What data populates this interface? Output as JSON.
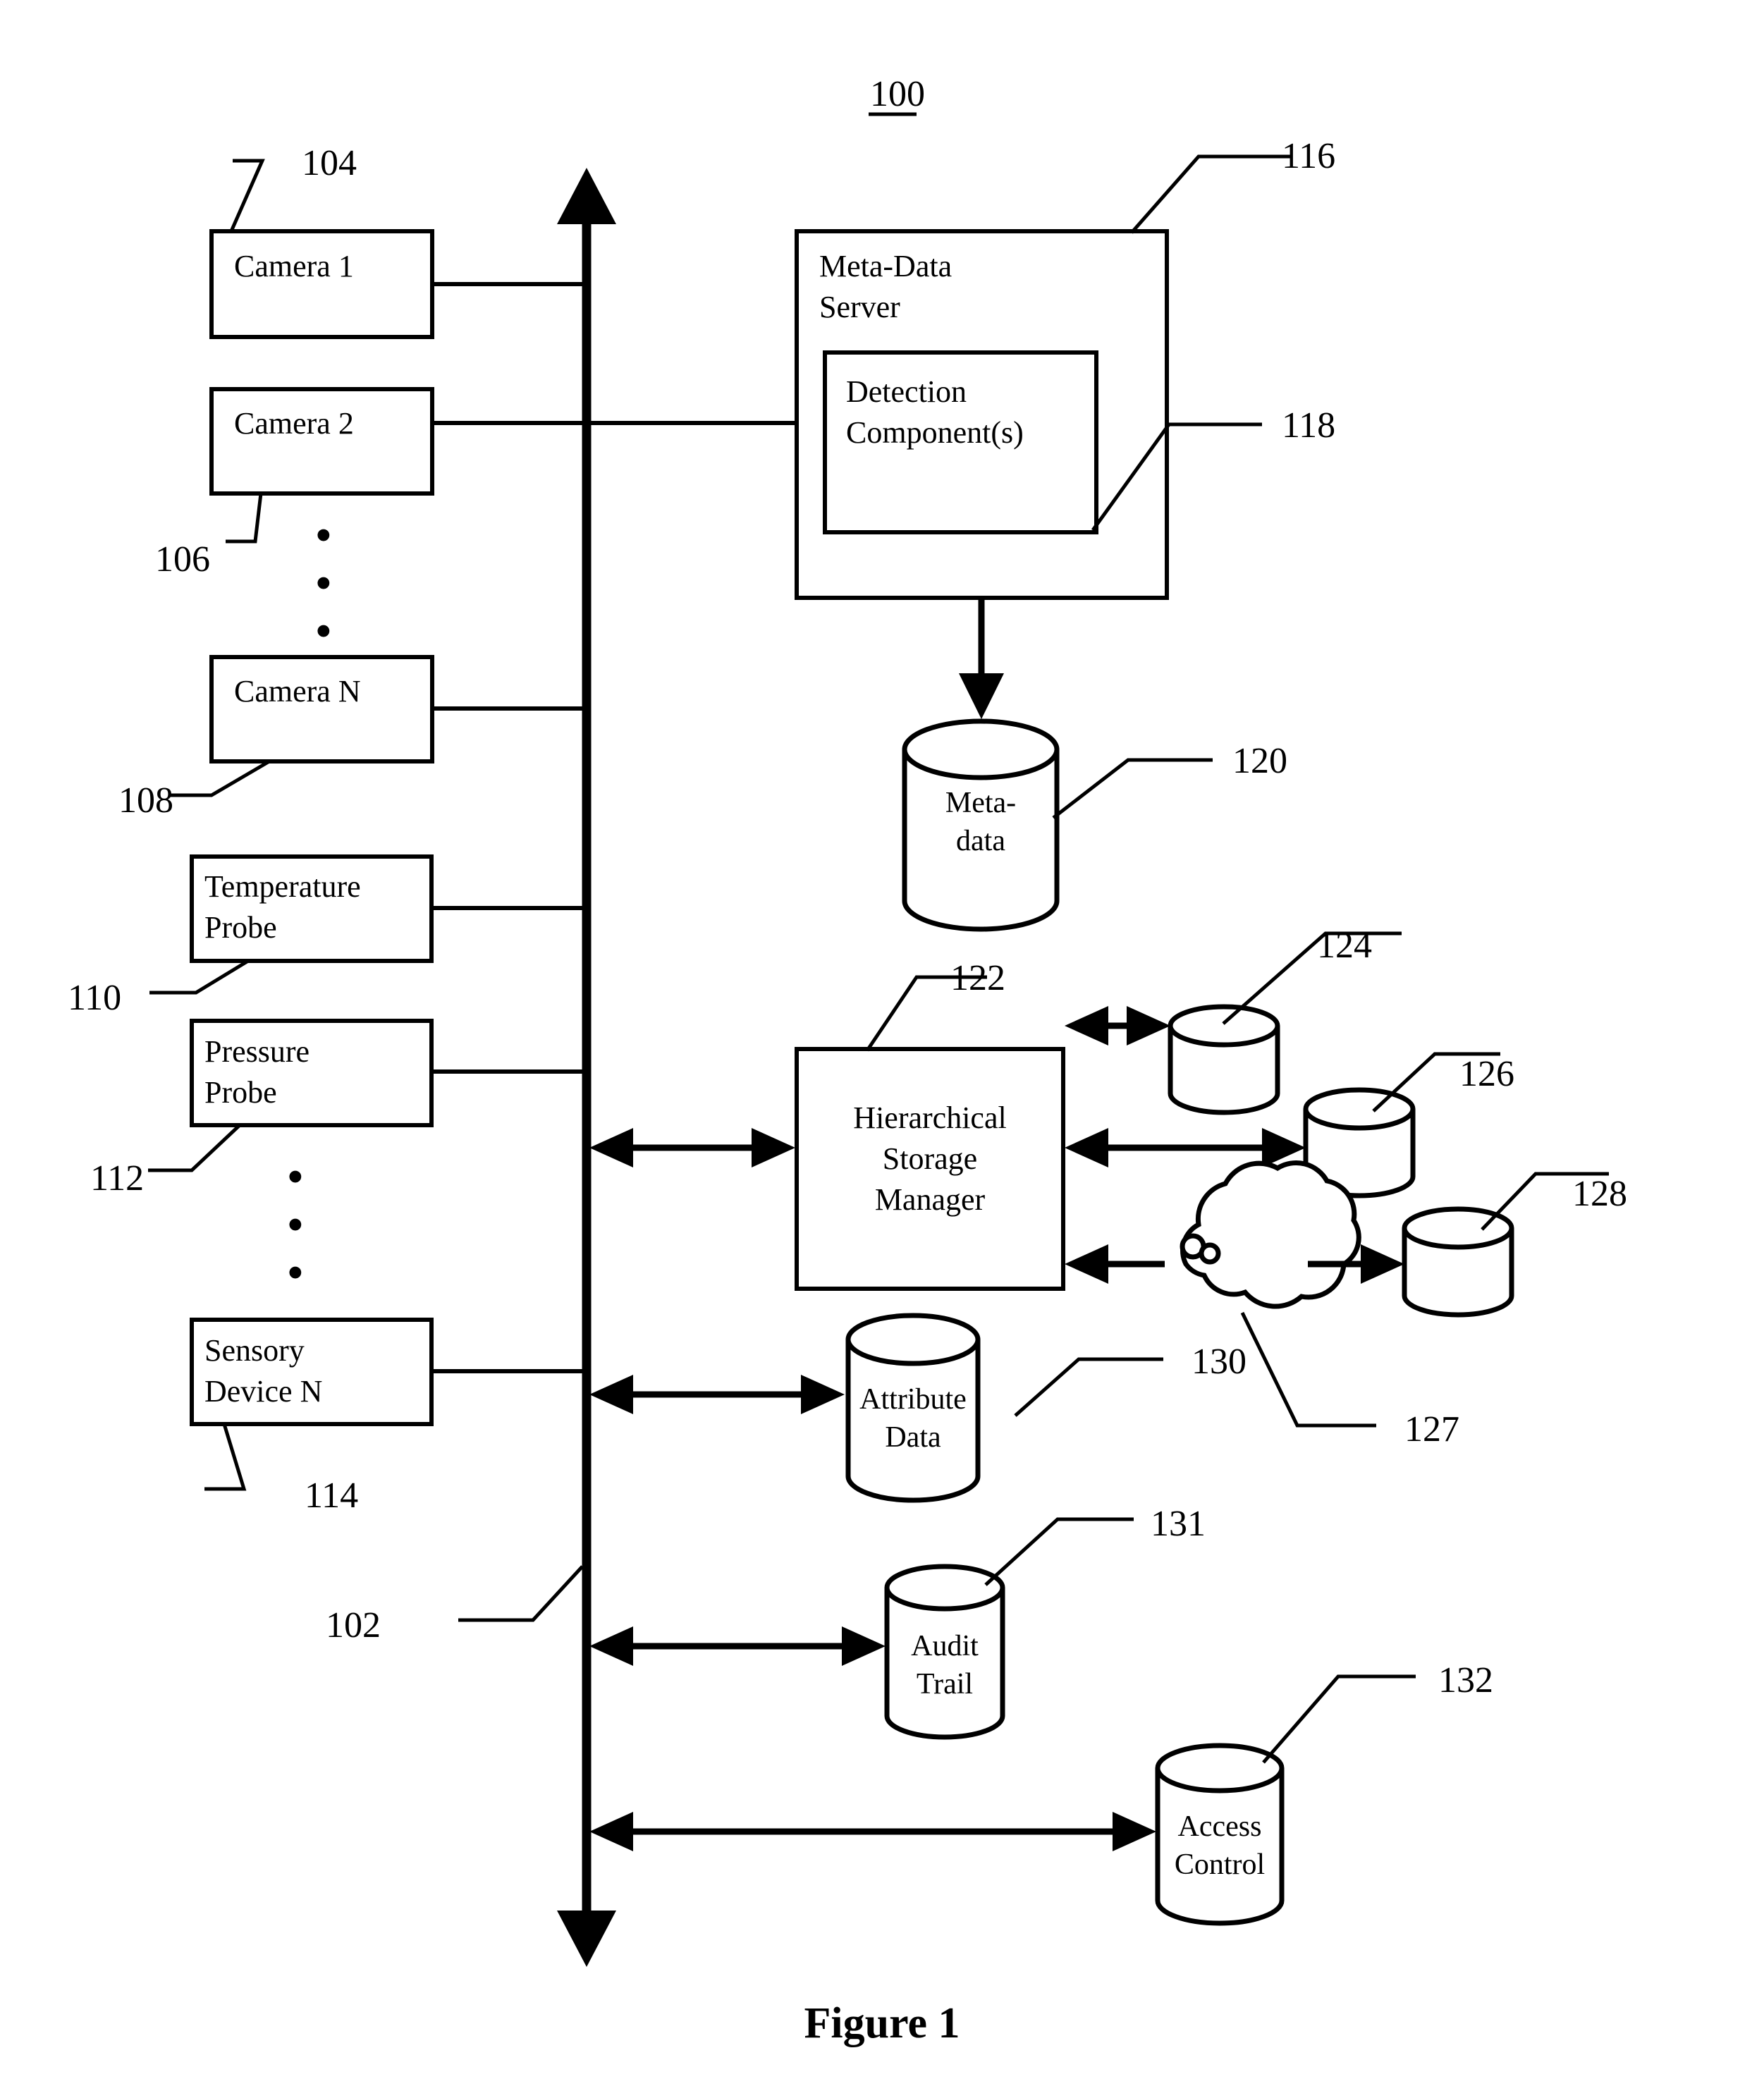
{
  "figure": {
    "system_number": "100",
    "caption": "Figure 1"
  },
  "boxes": [
    {
      "id": "camera1",
      "label_line1": "Camera 1",
      "label_line2": "",
      "ref": "104"
    },
    {
      "id": "camera2",
      "label_line1": "Camera 2",
      "label_line2": "",
      "ref": "106"
    },
    {
      "id": "cameraN",
      "label_line1": "Camera N",
      "label_line2": "",
      "ref": "108"
    },
    {
      "id": "temp",
      "label_line1": "Temperature",
      "label_line2": "Probe",
      "ref": "110"
    },
    {
      "id": "pressure",
      "label_line1": "Pressure",
      "label_line2": "Probe",
      "ref": "112"
    },
    {
      "id": "sensoryN",
      "label_line1": "Sensory",
      "label_line2": "Device N",
      "ref": "114"
    },
    {
      "id": "mdserver",
      "label_line1": "Meta-Data",
      "label_line2": "Server",
      "ref": "116"
    },
    {
      "id": "detect",
      "label_line1": "Detection",
      "label_line2": "Component(s)",
      "ref": "118"
    },
    {
      "id": "hsm",
      "label_line1": "Hierarchical",
      "label_line2": "Storage",
      "label_line3": "Manager",
      "ref": "122"
    }
  ],
  "cylinders": [
    {
      "id": "metadata",
      "label_line1": "Meta-",
      "label_line2": "data",
      "ref": "120"
    },
    {
      "id": "tier1",
      "label_line1": "",
      "label_line2": "",
      "ref": "124"
    },
    {
      "id": "tier2",
      "label_line1": "",
      "label_line2": "",
      "ref": "126"
    },
    {
      "id": "tier3",
      "label_line1": "",
      "label_line2": "",
      "ref": "128"
    },
    {
      "id": "attribute",
      "label_line1": "Attribute",
      "label_line2": "Data",
      "ref": "130"
    },
    {
      "id": "audit",
      "label_line1": "Audit",
      "label_line2": "Trail",
      "ref": "131"
    },
    {
      "id": "access",
      "label_line1": "Access",
      "label_line2": "Control",
      "ref": "132"
    }
  ],
  "cloud": {
    "id": "network",
    "ref": "127"
  },
  "bus": {
    "id": "system-bus",
    "ref": "102"
  },
  "ellipsis_glyph": "•",
  "colors": {
    "ink": "#000000",
    "paper": "#ffffff"
  }
}
